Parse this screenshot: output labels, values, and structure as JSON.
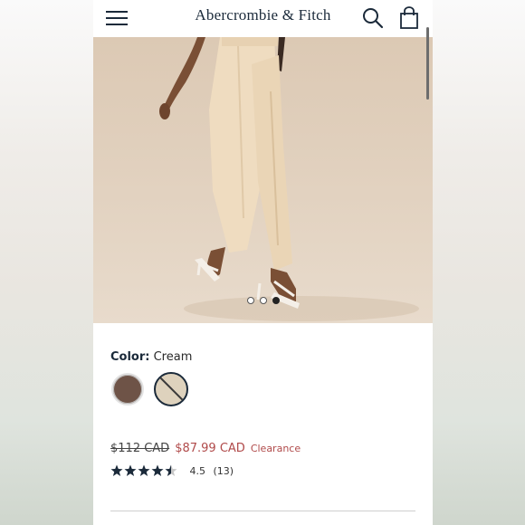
{
  "header": {
    "brand": "Abercrombie & Fitch",
    "menu_icon": "hamburger-menu-icon",
    "search_icon": "search-icon",
    "bag_icon": "shopping-bag-icon"
  },
  "gallery": {
    "image_count": 3,
    "active_index": 3
  },
  "product": {
    "color_label": "Color:",
    "color_value": "Cream",
    "swatches": [
      {
        "name": "Brown",
        "hex": "#6e5347",
        "selected": false
      },
      {
        "name": "Cream",
        "hex": "#ded2bd",
        "selected": true,
        "unavailable": true
      }
    ],
    "original_price": "$112 CAD",
    "sale_price": "$87.99 CAD",
    "badge": "Clearance",
    "rating_value": "4.5",
    "rating_count": "(13)",
    "rating_stars": 4.5
  },
  "colors": {
    "brand_navy": "#1b2a3a",
    "sale_red": "#b04a4a"
  }
}
